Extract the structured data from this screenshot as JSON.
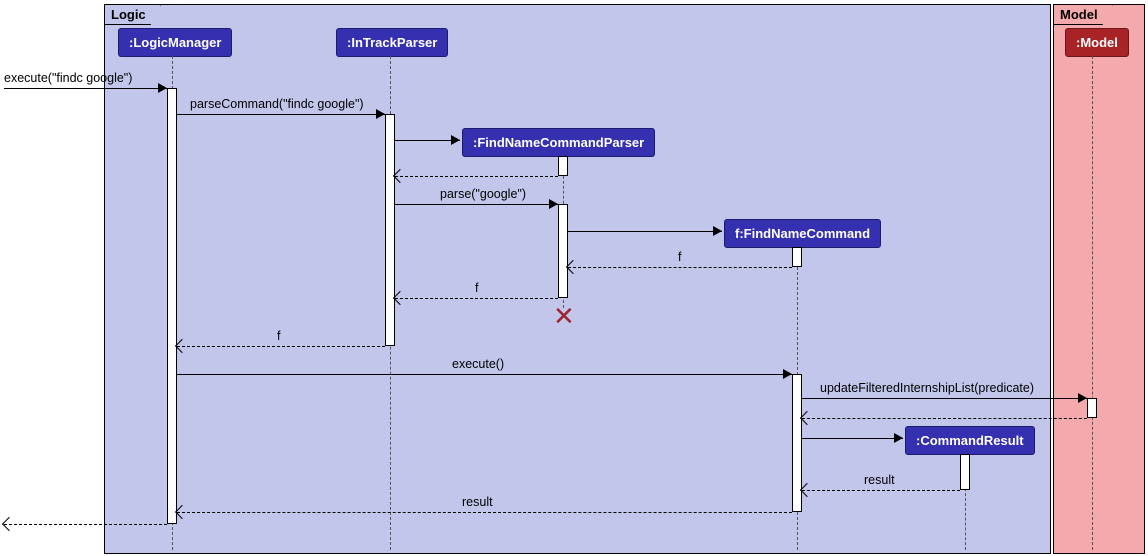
{
  "frames": {
    "logic": "Logic",
    "model": "Model"
  },
  "participants": {
    "logicManager": ":LogicManager",
    "inTrackParser": ":InTrackParser",
    "findNameCommandParser": ":FindNameCommandParser",
    "findNameCommand": "f:FindNameCommand",
    "commandResult": ":CommandResult",
    "model": ":Model"
  },
  "messages": {
    "executeFindc": "execute(\"findc google\")",
    "parseCommand": "parseCommand(\"findc google\")",
    "parseGoogle": "parse(\"google\")",
    "f1": "f",
    "f2": "f",
    "f3": "f",
    "execute": "execute()",
    "updateFiltered": "updateFilteredInternshipList(predicate)",
    "result1": "result",
    "result2": "result"
  }
}
